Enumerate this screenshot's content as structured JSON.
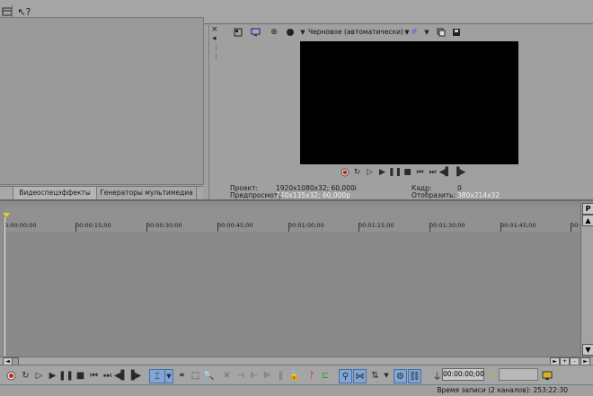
{
  "top_toolbar": {
    "icons": [
      "layout-icon",
      "help-pointer-icon"
    ]
  },
  "left_panel": {
    "tabs": [
      {
        "label": ""
      },
      {
        "label": "Видеоспецэффекты"
      },
      {
        "label": "Генераторы мультимедиа"
      }
    ]
  },
  "preview": {
    "quality": "Черновое (автоматически)",
    "project_label": "Проект:",
    "project_value": "1920x1080x32; 60,000i",
    "prerender_label": "Предпросмотр:",
    "prerender_value": "240x135x32; 60,000p",
    "frame_label": "Кадр:",
    "frame_value": "0",
    "display_label": "Отобразить:",
    "display_value": "380x214x32"
  },
  "timeline": {
    "ticks": [
      "0:00:00;00",
      "00:00:15;00",
      "00:00:30;00",
      "00:00:45;00",
      "00:01:00;00",
      "00:01:15;00",
      "00:01:30;00",
      "00:01:45;00",
      "00:02"
    ],
    "scroll_labels": {
      "top": "P",
      "plus": "+",
      "minus": "-"
    }
  },
  "bottom_toolbar": {
    "timecode": "00:00:00;00"
  },
  "status": {
    "text": "Время записи (2 каналов): 253:22:30"
  }
}
